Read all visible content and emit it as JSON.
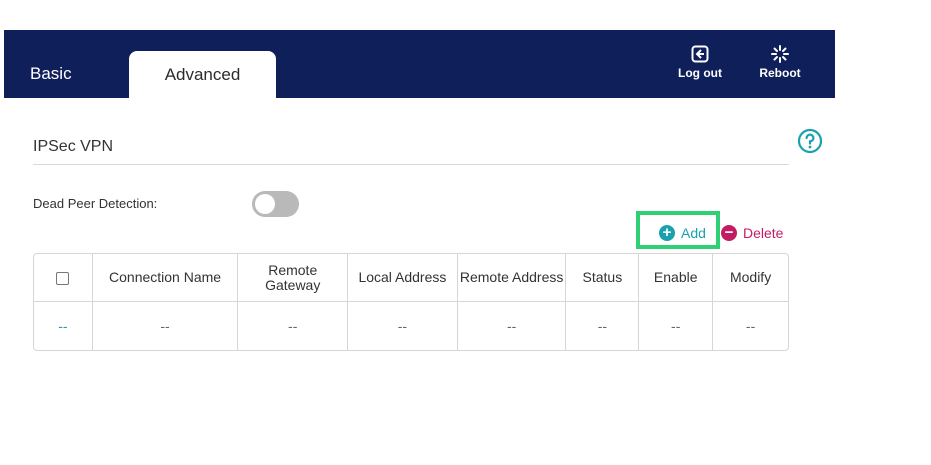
{
  "header": {
    "tabs": {
      "basic": "Basic",
      "advanced": "Advanced"
    },
    "logout_label": "Log out",
    "reboot_label": "Reboot",
    "background_color": "#0f1f5a"
  },
  "page": {
    "title": "IPSec VPN"
  },
  "dead_peer_detection": {
    "label": "Dead Peer Detection:",
    "enabled": false
  },
  "actions": {
    "add_label": "Add",
    "delete_label": "Delete",
    "add_color": "#19a1ae",
    "delete_color": "#c21d64",
    "highlight_color": "#2fd073"
  },
  "table": {
    "columns": {
      "connection_name": "Connection Name",
      "remote_gateway_1": "Remote",
      "remote_gateway_2": "Gateway",
      "local_address": "Local Address",
      "remote_address": "Remote Address",
      "status": "Status",
      "enable": "Enable",
      "modify": "Modify"
    },
    "rows": [
      [
        "--",
        "--",
        "--",
        "--",
        "--",
        "--",
        "--",
        "--"
      ]
    ]
  }
}
